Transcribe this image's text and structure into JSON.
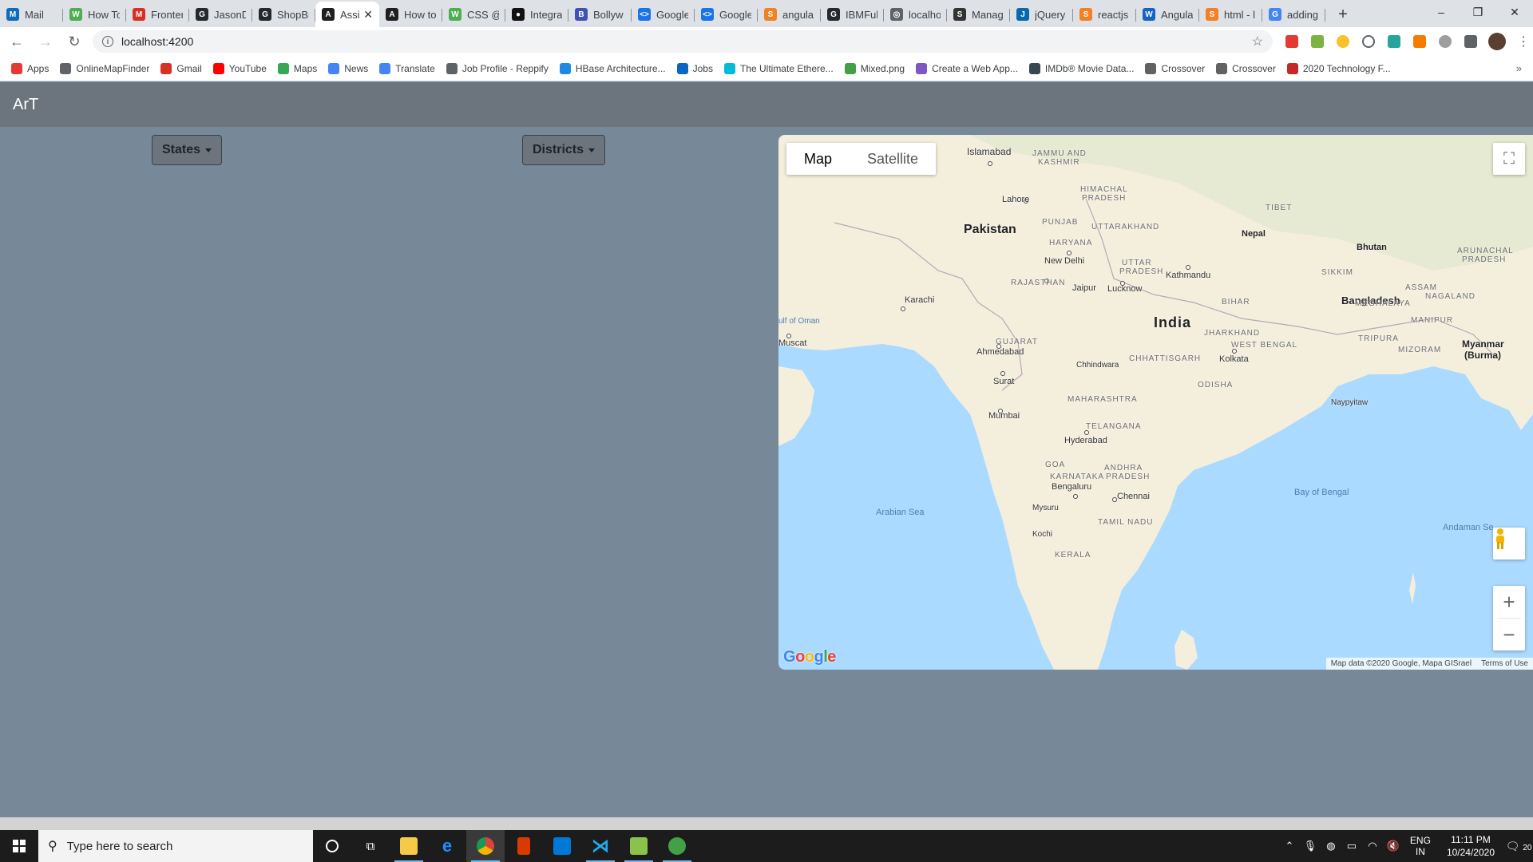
{
  "browser": {
    "tabs": [
      {
        "label": "Mail",
        "color": "#0f6cbd",
        "glyph": "M"
      },
      {
        "label": "How To",
        "color": "#4caf50",
        "glyph": "W"
      },
      {
        "label": "Fronter",
        "color": "#d93025",
        "glyph": "M"
      },
      {
        "label": "JasonD",
        "color": "#24292e",
        "glyph": "G"
      },
      {
        "label": "ShopBr",
        "color": "#24292e",
        "glyph": "G"
      },
      {
        "label": "Assi",
        "color": "#1f1f1f",
        "glyph": "A",
        "active": true
      },
      {
        "label": "How to",
        "color": "#1f1f1f",
        "glyph": "A"
      },
      {
        "label": "CSS @r",
        "color": "#4caf50",
        "glyph": "W"
      },
      {
        "label": "Integra",
        "color": "#111",
        "glyph": "●"
      },
      {
        "label": "Bollyw",
        "color": "#3f51b5",
        "glyph": "B"
      },
      {
        "label": "Google",
        "color": "#1a73e8",
        "glyph": "<>"
      },
      {
        "label": "Google",
        "color": "#1a73e8",
        "glyph": "<>"
      },
      {
        "label": "angula",
        "color": "#f48024",
        "glyph": "S"
      },
      {
        "label": "IBMFul",
        "color": "#24292e",
        "glyph": "G"
      },
      {
        "label": "localho",
        "color": "#5f6368",
        "glyph": "◎"
      },
      {
        "label": "Manag",
        "color": "#333",
        "glyph": "S"
      },
      {
        "label": "jQuery",
        "color": "#0769ad",
        "glyph": "J"
      },
      {
        "label": "reactjs",
        "color": "#f48024",
        "glyph": "S"
      },
      {
        "label": "Angula",
        "color": "#1565c0",
        "glyph": "W"
      },
      {
        "label": "html - l",
        "color": "#f48024",
        "glyph": "S"
      },
      {
        "label": "adding",
        "color": "#4285f4",
        "glyph": "G"
      }
    ],
    "new_tab": "+",
    "window_controls": {
      "minimize": "–",
      "maximize": "❐",
      "close": "✕"
    },
    "url": "localhost:4200",
    "bookmarks": [
      {
        "label": "Apps",
        "color": "#e53935"
      },
      {
        "label": "OnlineMapFinder",
        "color": "#5f6368"
      },
      {
        "label": "Gmail",
        "color": "#d93025"
      },
      {
        "label": "YouTube",
        "color": "#ff0000"
      },
      {
        "label": "Maps",
        "color": "#34a853"
      },
      {
        "label": "News",
        "color": "#4285f4"
      },
      {
        "label": "Translate",
        "color": "#4285f4"
      },
      {
        "label": "Job Profile - Reppify",
        "color": "#5f6368"
      },
      {
        "label": "HBase Architecture...",
        "color": "#1e88e5"
      },
      {
        "label": "Jobs",
        "color": "#0a66c2"
      },
      {
        "label": "The Ultimate Ethere...",
        "color": "#00bcd4"
      },
      {
        "label": "Mixed.png",
        "color": "#43a047"
      },
      {
        "label": "Create a Web App...",
        "color": "#7e57c2"
      },
      {
        "label": "IMDb® Movie Data...",
        "color": "#37474f"
      },
      {
        "label": "Crossover",
        "color": "#616161"
      },
      {
        "label": "Crossover",
        "color": "#616161"
      },
      {
        "label": "2020 Technology F...",
        "color": "#c62828"
      }
    ],
    "bookmarks_more": "»"
  },
  "app": {
    "brand": "ArT",
    "states_label": "States",
    "districts_label": "Districts"
  },
  "map": {
    "type_map": "Map",
    "type_satellite": "Satellite",
    "zoom_in": "+",
    "zoom_out": "−",
    "logo": "Google",
    "attribution": "Map data ©2020 Google, Mapa GISrael",
    "terms": "Terms of Use",
    "labels": {
      "pakistan": "Pakistan",
      "india": "India",
      "nepal": "Nepal",
      "bhutan": "Bhutan",
      "bangladesh": "Bangladesh",
      "myanmar_1": "Myanmar",
      "myanmar_2": "(Burma)",
      "islamabad": "Islamabad",
      "lahore": "Lahore",
      "new_delhi": "New Delhi",
      "karachi": "Karachi",
      "muscat": "Muscat",
      "jaipur": "Jaipur",
      "lucknow": "Lucknow",
      "kathmandu": "Kathmandu",
      "ahmedabad": "Ahmedabad",
      "surat": "Surat",
      "mumbai": "Mumbai",
      "chhindwara": "Chhindwara",
      "kolkata": "Kolkata",
      "hyderabad": "Hyderabad",
      "bengaluru": "Bengaluru",
      "chennai": "Chennai",
      "mysuru": "Mysuru",
      "kochi": "Kochi",
      "naypyitaw": "Naypyitaw",
      "jammu_kashmir_1": "JAMMU AND",
      "jammu_kashmir_2": "KASHMIR",
      "himachal_1": "HIMACHAL",
      "himachal_2": "PRADESH",
      "punjab": "PUNJAB",
      "uttarakhand": "UTTARAKHAND",
      "haryana": "HARYANA",
      "tibet": "TIBET",
      "uttar_pradesh_1": "UTTAR",
      "uttar_pradesh_2": "PRADESH",
      "rajasthan": "RAJASTHAN",
      "sikkim": "SIKKIM",
      "arunachal_1": "ARUNACHAL",
      "arunachal_2": "PRADESH",
      "assam": "ASSAM",
      "nagaland": "NAGALAND",
      "bihar": "BIHAR",
      "meghalaya": "MEGHALAYA",
      "manipur": "MANIPUR",
      "gujarat": "GUJARAT",
      "jharkhand": "JHARKHAND",
      "west_bengal": "WEST BENGAL",
      "tripura": "TRIPURA",
      "mizoram": "MIZORAM",
      "chhattisgarh": "CHHATTISGARH",
      "odisha": "ODISHA",
      "maharashtra": "MAHARASHTRA",
      "telangana": "TELANGANA",
      "goa": "GOA",
      "andhra_1": "ANDHRA",
      "andhra_2": "PRADESH",
      "karnataka": "KARNATAKA",
      "tamil_nadu": "TAMIL NADU",
      "kerala": "KERALA",
      "gulf_of_oman": "ulf of Oman",
      "arabian_sea": "Arabian Sea",
      "bay_of_bengal": "Bay of Bengal",
      "andaman_sea": "Andaman Se"
    }
  },
  "taskbar": {
    "search_placeholder": "Type here to search",
    "lang_1": "ENG",
    "lang_2": "IN",
    "time": "11:11 PM",
    "date": "10/24/2020",
    "notifications": "20"
  },
  "colors": {
    "page_bg": "#778899",
    "header_bg": "#6c757d",
    "water": "#aadaff",
    "land": "#f4efdd"
  }
}
